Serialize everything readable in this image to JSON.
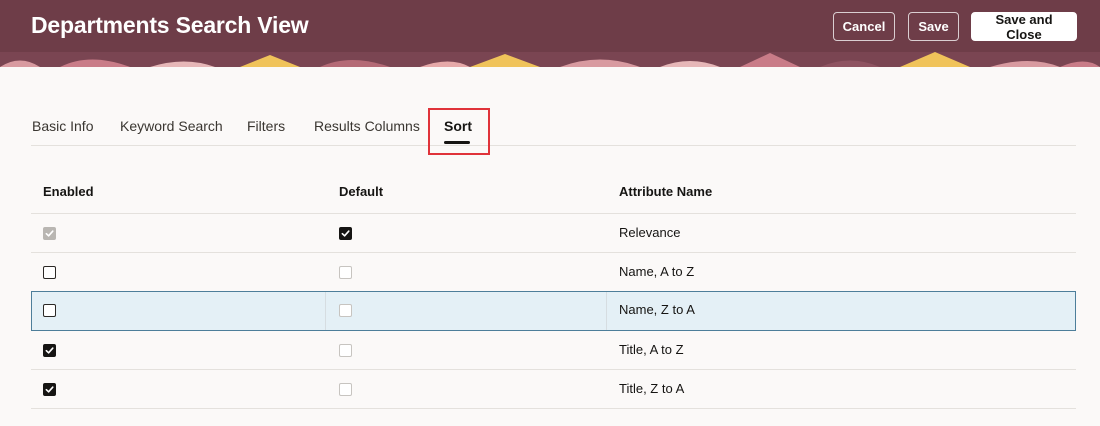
{
  "header": {
    "title": "Departments Search View",
    "cancel_label": "Cancel",
    "save_label": "Save",
    "save_close_label": "Save and Close",
    "background_color": "#6e3d48"
  },
  "tabs": [
    {
      "label": "Basic Info",
      "active": false
    },
    {
      "label": "Keyword Search",
      "active": false
    },
    {
      "label": "Filters",
      "active": false
    },
    {
      "label": "Results Columns",
      "active": false
    },
    {
      "label": "Sort",
      "active": true
    }
  ],
  "table": {
    "columns": [
      "Enabled",
      "Default",
      "Attribute Name"
    ],
    "rows": [
      {
        "enabled": "checked-disabled",
        "default": "checked",
        "attribute": "Relevance",
        "selected": false
      },
      {
        "enabled": "unchecked",
        "default": "unchecked-disabled",
        "attribute": "Name, A to Z",
        "selected": false
      },
      {
        "enabled": "unchecked",
        "default": "unchecked-disabled",
        "attribute": "Name, Z to A",
        "selected": true
      },
      {
        "enabled": "checked",
        "default": "unchecked-disabled",
        "attribute": "Title, A to Z",
        "selected": false
      },
      {
        "enabled": "checked",
        "default": "unchecked-disabled",
        "attribute": "Title, Z to A",
        "selected": false
      }
    ]
  },
  "colors": {
    "highlight_box": "#e0333a",
    "selected_row_bg": "#e4f0f6"
  }
}
